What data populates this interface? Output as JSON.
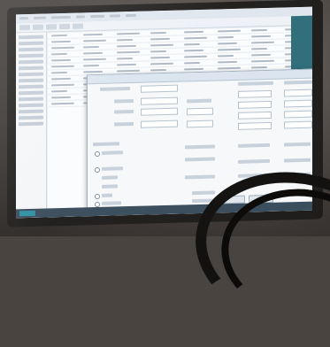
{
  "photo": {
    "subject": "computer-monitor-photo",
    "notes": ""
  },
  "app": {
    "menu_items": [
      "",
      "",
      "",
      "",
      "",
      "",
      ""
    ],
    "toolbar_buttons": [
      "",
      "",
      "",
      "",
      ""
    ],
    "nav_items": [
      "",
      "",
      "",
      "",
      "",
      "",
      "",
      "",
      "",
      "",
      "",
      "",
      "",
      "",
      "",
      "",
      "",
      "",
      "",
      ""
    ],
    "grid_rows": 12,
    "dialog": {
      "title": "",
      "left_fields": [
        "",
        "",
        "",
        "",
        "",
        "",
        "",
        "",
        "",
        ""
      ],
      "right_fields": [
        "",
        "",
        "",
        "",
        "",
        "",
        "",
        "",
        "",
        ""
      ],
      "radio_options": [
        "",
        "",
        "",
        "",
        ""
      ],
      "buttons": [
        "",
        ""
      ]
    }
  },
  "colors": {
    "screen_bg": "#e9eef4",
    "dialog_bg": "#f6f8fa",
    "accent": "#2f6d7a",
    "taskbar": "#3a4d5c"
  }
}
